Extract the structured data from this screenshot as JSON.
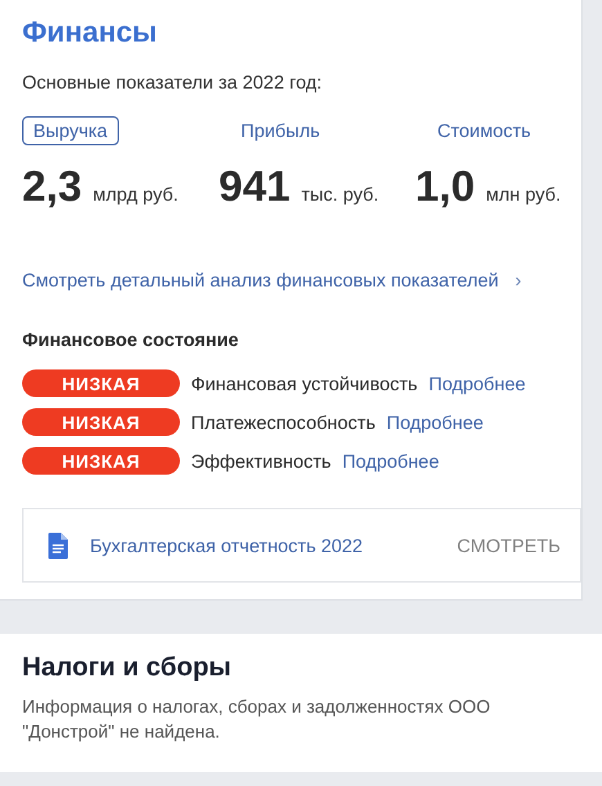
{
  "finance": {
    "title": "Финансы",
    "subtitle": "Основные показатели за 2022 год:",
    "metrics": [
      {
        "label": "Выручка",
        "selected": true,
        "value": "2,3",
        "unit": "млрд руб."
      },
      {
        "label": "Прибыль",
        "selected": false,
        "value": "941",
        "unit": "тыс. руб."
      },
      {
        "label": "Стоимость",
        "selected": false,
        "value": "1,0",
        "unit": "млн руб."
      }
    ],
    "analysis_link": {
      "text": "Смотреть детальный анализ финансовых показателей",
      "arrow": "›"
    },
    "state_heading": "Финансовое состояние",
    "indicators": [
      {
        "badge": "НИЗКАЯ",
        "color": "#ee3b22",
        "name": "Финансовая устойчивость",
        "link": "Подробнее"
      },
      {
        "badge": "НИЗКАЯ",
        "color": "#ee3b22",
        "name": "Платежеспособность",
        "link": "Подробнее"
      },
      {
        "badge": "НИЗКАЯ",
        "color": "#ee3b22",
        "name": "Эффективность",
        "link": "Подробнее"
      }
    ],
    "report": {
      "title": "Бухгалтерская отчетность 2022",
      "action": "СМОТРЕТЬ"
    }
  },
  "taxes": {
    "title": "Налоги и сборы",
    "text": "Информация о налогах, сборах и задолженностях ООО \"Донстрой\" не найдена."
  }
}
